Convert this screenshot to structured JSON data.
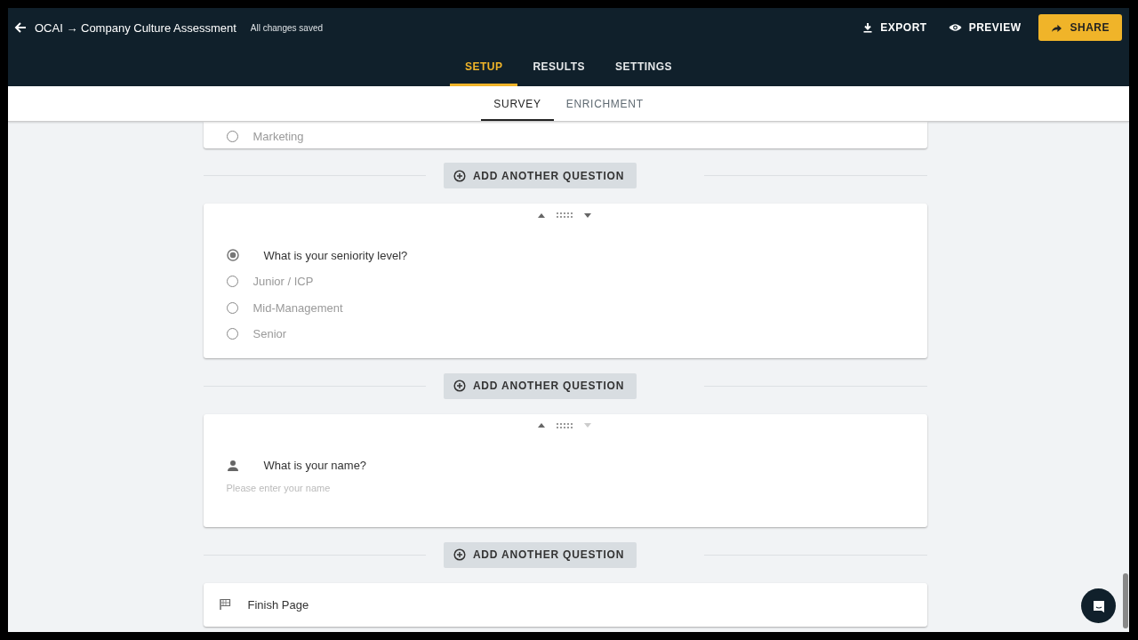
{
  "header": {
    "title": "OCAI → Company Culture Assessment",
    "save_status": "All changes saved",
    "actions": [
      {
        "kind": "export",
        "label": "EXPORT"
      },
      {
        "kind": "preview",
        "label": "PREVIEW"
      },
      {
        "kind": "share",
        "label": "SHARE"
      }
    ]
  },
  "tabs": [
    {
      "label": "SETUP",
      "selected": true
    },
    {
      "label": "RESULTS",
      "selected": false
    },
    {
      "label": "SETTINGS",
      "selected": false
    }
  ],
  "subtabs": [
    {
      "label": "SURVEY",
      "selected": true
    },
    {
      "label": "ENRICHMENT",
      "selected": false
    }
  ],
  "cards": [
    {
      "kind": "partial",
      "options": [
        {
          "label": "Marketing",
          "selected": false
        }
      ]
    },
    {
      "kind": "add",
      "label": "ADD ANOTHER QUESTION"
    },
    {
      "kind": "choice",
      "question": "What is your seniority level?",
      "move_up_disabled": false,
      "move_down_disabled": false,
      "options": [
        {
          "label": "Junior / ICP",
          "selected": false
        },
        {
          "label": "Mid-Management",
          "selected": false
        },
        {
          "label": "Senior",
          "selected": false
        }
      ]
    },
    {
      "kind": "add",
      "label": "ADD ANOTHER QUESTION"
    },
    {
      "kind": "name",
      "question": "What is your name?",
      "placeholder": "Please enter your name",
      "move_up_disabled": false,
      "move_down_disabled": true
    },
    {
      "kind": "add",
      "label": "ADD ANOTHER QUESTION"
    },
    {
      "kind": "finish",
      "label": "Finish Page"
    }
  ]
}
